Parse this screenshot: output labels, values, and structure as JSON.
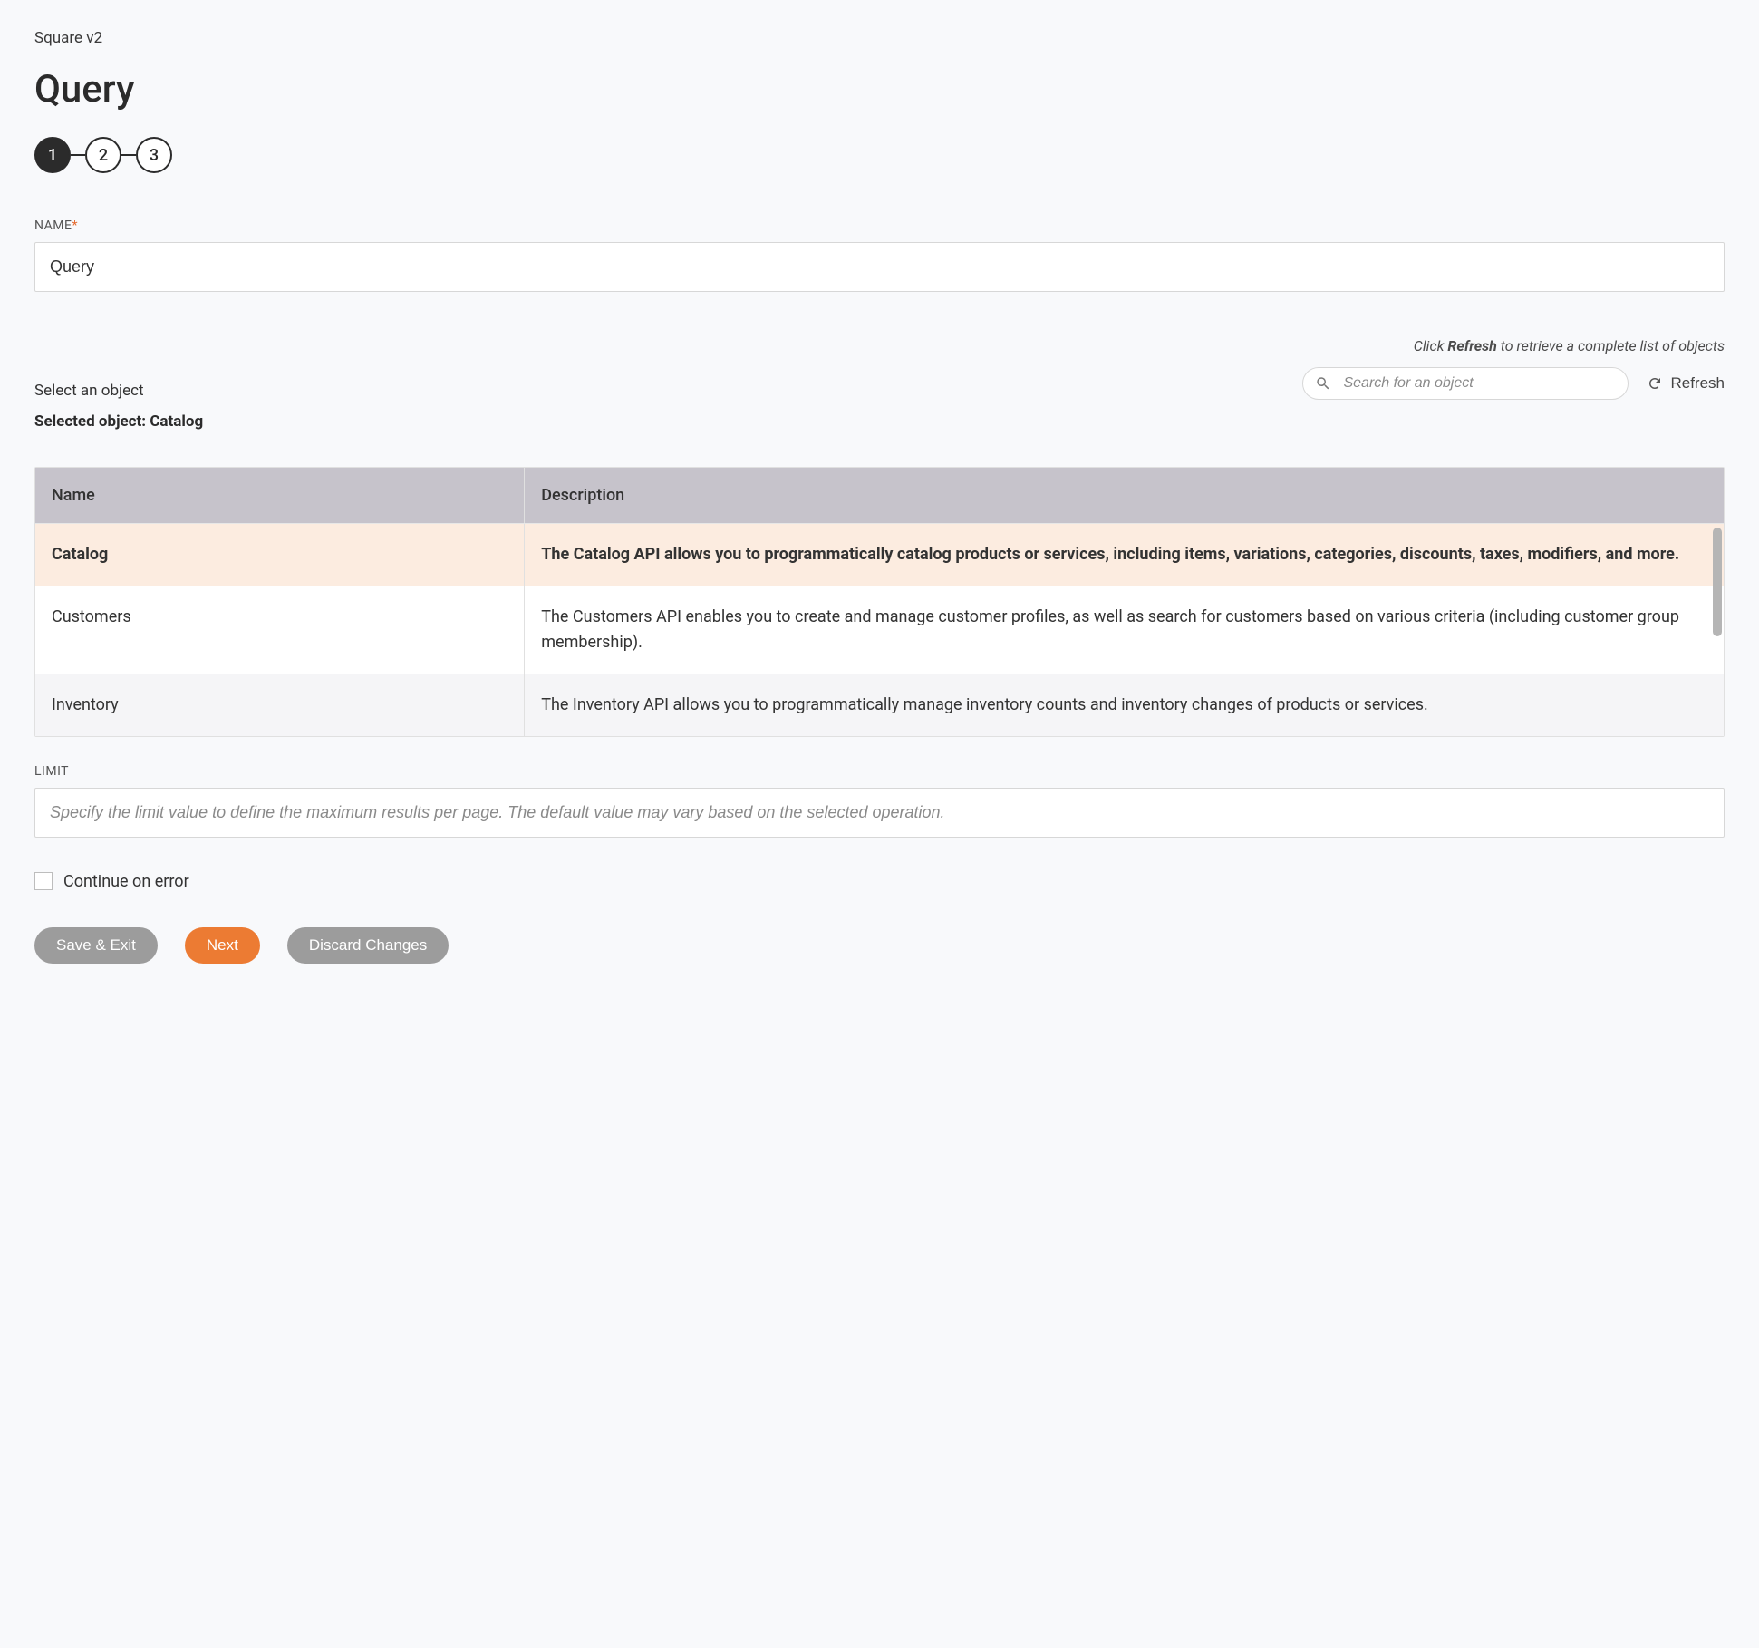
{
  "breadcrumb": {
    "label": "Square v2"
  },
  "page": {
    "title": "Query"
  },
  "stepper": {
    "steps": [
      "1",
      "2",
      "3"
    ],
    "active_index": 0
  },
  "fields": {
    "name": {
      "label": "NAME",
      "required_marker": "*",
      "value": "Query"
    },
    "limit": {
      "label": "LIMIT",
      "placeholder": "Specify the limit value to define the maximum results per page. The default value may vary based on the selected operation.",
      "value": ""
    }
  },
  "object_selector": {
    "prompt": "Select an object",
    "hint_prefix": "Click ",
    "hint_bold": "Refresh",
    "hint_suffix": " to retrieve a complete list of objects",
    "selected_prefix": "Selected object: ",
    "selected_value": "Catalog",
    "search_placeholder": "Search for an object",
    "refresh_label": "Refresh",
    "columns": {
      "name": "Name",
      "description": "Description"
    },
    "rows": [
      {
        "name": "Catalog",
        "description": "The Catalog API allows you to programmatically catalog products or services, including items, variations, categories, discounts, taxes, modifiers, and more.",
        "selected": true
      },
      {
        "name": "Customers",
        "description": "The Customers API enables you to create and manage customer profiles, as well as search for customers based on various criteria (including customer group membership).",
        "selected": false
      },
      {
        "name": "Inventory",
        "description": "The Inventory API allows you to programmatically manage inventory counts and inventory changes of products or services.",
        "selected": false
      }
    ]
  },
  "continue_on_error": {
    "label": "Continue on error",
    "checked": false
  },
  "footer": {
    "save_exit": "Save & Exit",
    "next": "Next",
    "discard": "Discard Changes"
  }
}
